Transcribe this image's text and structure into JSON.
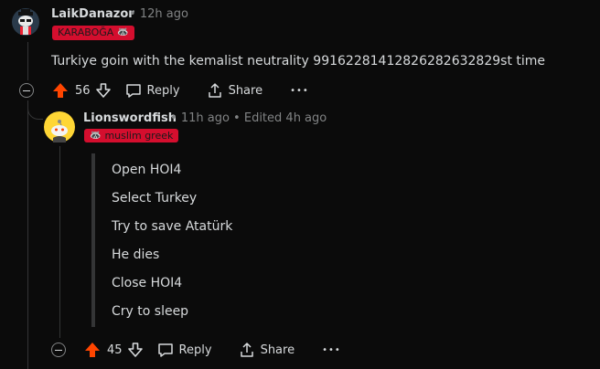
{
  "comment1": {
    "username": "LaikDanazor",
    "time": "12h ago",
    "flair": "KARABOĞA",
    "flair_emoji": "🦝",
    "body": "Turkiye goin with the kemalist neutrality 99162281412826282632829st time",
    "votes": "56",
    "reply_label": "Reply",
    "share_label": "Share",
    "more_label": "•••"
  },
  "comment2": {
    "username": "Lionswordfish",
    "time": "11h ago",
    "edited": "Edited 4h ago",
    "flair": "muslim greek",
    "flair_emoji": "🦝",
    "quote_lines": [
      "Open HOI4",
      "Select Turkey",
      "Try to save Atatürk",
      "He dies",
      "Close HOI4",
      "Cry to sleep"
    ],
    "votes": "45",
    "reply_label": "Reply",
    "share_label": "Share",
    "more_label": "•••"
  },
  "separator": "•",
  "colors": {
    "background": "#0b0b0b",
    "upvote_active": "#ff4500",
    "flair_bg": "#d40e2e",
    "meta_text": "#818384"
  }
}
